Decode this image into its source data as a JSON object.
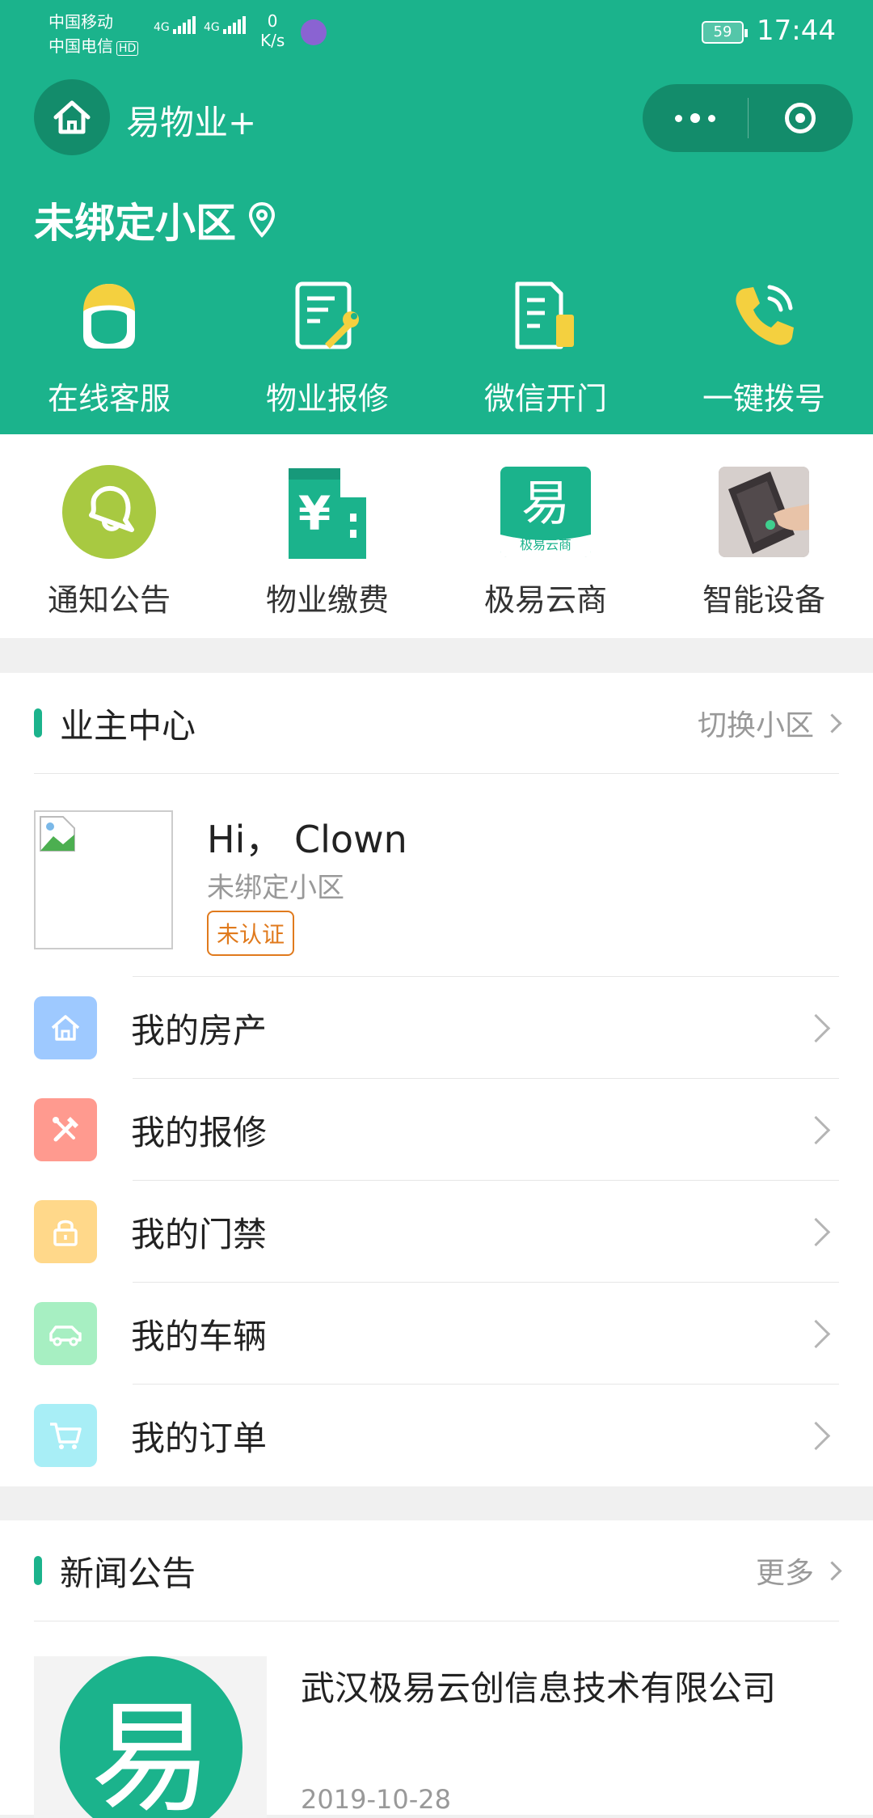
{
  "status": {
    "carrier1": "中国移动",
    "carrier2": "中国电信",
    "hd": "HD",
    "net1": "4G",
    "net2": "4G",
    "speed_value": "0",
    "speed_unit": "K/s",
    "battery": "59",
    "time": "17:44"
  },
  "nav": {
    "app_title": "易物业+"
  },
  "community": {
    "name": "未绑定小区"
  },
  "quick_actions": [
    {
      "label": "在线客服",
      "icon": "customer-service-icon"
    },
    {
      "label": "物业报修",
      "icon": "repair-icon"
    },
    {
      "label": "微信开门",
      "icon": "door-open-icon"
    },
    {
      "label": "一键拨号",
      "icon": "phone-icon"
    }
  ],
  "services": [
    {
      "label": "通知公告",
      "icon": "bell-icon"
    },
    {
      "label": "物业缴费",
      "icon": "building-yuan-icon"
    },
    {
      "label": "极易云商",
      "icon": "jiyi-store-logo",
      "logo_text": "易",
      "logo_sub": "极易云商"
    },
    {
      "label": "智能设备",
      "icon": "smart-lock-photo"
    }
  ],
  "owner_center": {
    "title": "业主中心",
    "switch_label": "切换小区",
    "greeting": "Hi， Clown",
    "community": "未绑定小区",
    "badge": "未认证"
  },
  "menu": [
    {
      "label": "我的房产",
      "icon": "house-icon",
      "color": "#9ec9ff"
    },
    {
      "label": "我的报修",
      "icon": "tools-icon",
      "color": "#ff9a8f"
    },
    {
      "label": "我的门禁",
      "icon": "lock-icon",
      "color": "#ffd88a"
    },
    {
      "label": "我的车辆",
      "icon": "car-icon",
      "color": "#a7efc2"
    },
    {
      "label": "我的订单",
      "icon": "cart-icon",
      "color": "#a8eef6"
    }
  ],
  "news": {
    "title": "新闻公告",
    "more_label": "更多",
    "items": [
      {
        "title": "武汉极易云创信息技术有限公司",
        "date": "2019-10-28",
        "thumb_text": "易"
      }
    ]
  },
  "colors": {
    "brand": "#1bb38c",
    "badge": "#e07a1d"
  }
}
